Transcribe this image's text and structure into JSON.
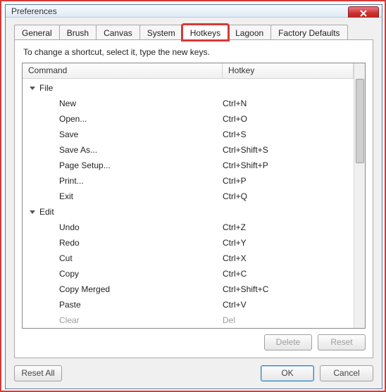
{
  "window": {
    "title": "Preferences"
  },
  "tabs": {
    "general": "General",
    "brush": "Brush",
    "canvas": "Canvas",
    "system": "System",
    "hotkeys": "Hotkeys",
    "lagoon": "Lagoon",
    "factory": "Factory Defaults"
  },
  "instruction": "To change a shortcut, select it, type the new keys.",
  "columns": {
    "command": "Command",
    "hotkey": "Hotkey"
  },
  "groups": [
    {
      "name": "File",
      "items": [
        {
          "cmd": "New",
          "hk": "Ctrl+N"
        },
        {
          "cmd": "Open...",
          "hk": "Ctrl+O"
        },
        {
          "cmd": "Save",
          "hk": "Ctrl+S"
        },
        {
          "cmd": "Save As...",
          "hk": "Ctrl+Shift+S"
        },
        {
          "cmd": "Page Setup...",
          "hk": "Ctrl+Shift+P"
        },
        {
          "cmd": "Print...",
          "hk": "Ctrl+P"
        },
        {
          "cmd": "Exit",
          "hk": "Ctrl+Q"
        }
      ]
    },
    {
      "name": "Edit",
      "items": [
        {
          "cmd": "Undo",
          "hk": "Ctrl+Z"
        },
        {
          "cmd": "Redo",
          "hk": "Ctrl+Y"
        },
        {
          "cmd": "Cut",
          "hk": "Ctrl+X"
        },
        {
          "cmd": "Copy",
          "hk": "Ctrl+C"
        },
        {
          "cmd": "Copy Merged",
          "hk": "Ctrl+Shift+C"
        },
        {
          "cmd": "Paste",
          "hk": "Ctrl+V"
        },
        {
          "cmd": "Clear",
          "hk": "Del"
        }
      ]
    }
  ],
  "buttons": {
    "delete": "Delete",
    "reset": "Reset",
    "reset_all": "Reset All",
    "ok": "OK",
    "cancel": "Cancel"
  }
}
